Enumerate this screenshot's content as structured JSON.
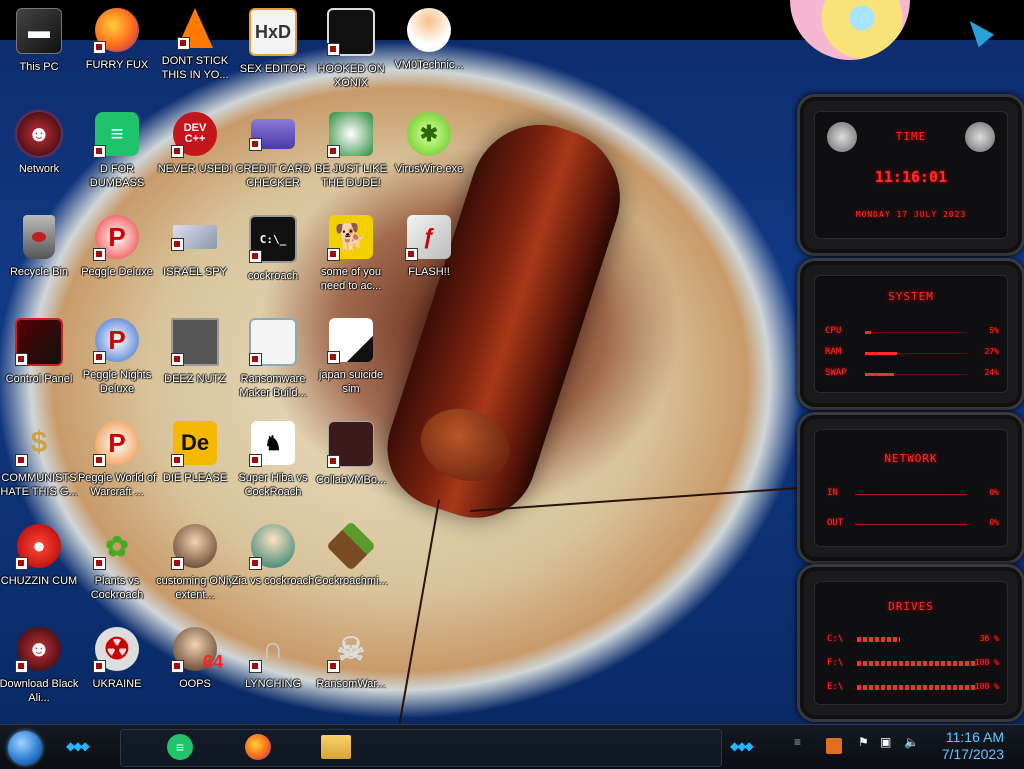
{
  "desktop": {
    "icons": [
      {
        "label": "This PC"
      },
      {
        "label": "FURRY FUX"
      },
      {
        "label": "DONT STICK THIS IN YO..."
      },
      {
        "label": "SEX EDITOR"
      },
      {
        "label": "HOOKED ON XONIX"
      },
      {
        "label": "VM0Technic..."
      },
      {
        "label": "Network"
      },
      {
        "label": "D FOR DUMBASS"
      },
      {
        "label": "NEVER USED!"
      },
      {
        "label": "CREDIT CARD CHECKER"
      },
      {
        "label": "BE JUST LIKE THE DUDE!"
      },
      {
        "label": "VirusWire.exe"
      },
      {
        "label": "Recycle Bin"
      },
      {
        "label": "Peggle Deluxe"
      },
      {
        "label": "ISRAEL SPY"
      },
      {
        "label": "cockroach"
      },
      {
        "label": "some of you need to ac..."
      },
      {
        "label": "FLASH!!"
      },
      {
        "label": "Control Panel"
      },
      {
        "label": "Peggle Nights Deluxe"
      },
      {
        "label": "DEEZ NUTZ"
      },
      {
        "label": "Ransomware Maker Build..."
      },
      {
        "label": "japan suicide sim"
      },
      {
        "label": "COMMUNISTS HATE THIS G..."
      },
      {
        "label": "Peggle World of Warcraft ..."
      },
      {
        "label": "DIE PLEASE"
      },
      {
        "label": "Super Hiba vs CockRoach"
      },
      {
        "label": "CollabVMBo..."
      },
      {
        "label": "CHUZZIN CUM"
      },
      {
        "label": "Plants vs Cockroach"
      },
      {
        "label": "customing ONly extent..."
      },
      {
        "label": "Zia vs cockroach"
      },
      {
        "label": "Cockroachmi..."
      },
      {
        "label": "Download Black Ali..."
      },
      {
        "label": "UKRAINE"
      },
      {
        "label": "OOPS"
      },
      {
        "label": "LYNCHING"
      },
      {
        "label": "RansomWar..."
      }
    ],
    "icon_badges": {
      "dev": "DEV",
      "dev_sub": "C++",
      "de": "De",
      "cmd": "C:\\_",
      "oops_num": "64"
    }
  },
  "gadgets": {
    "time": {
      "title": "TIME",
      "time": "11:16:01",
      "date": "MONDAY 17 JULY 2023"
    },
    "system": {
      "title": "SYSTEM",
      "rows": [
        {
          "label": "CPU",
          "value": "5%",
          "level": 0.05
        },
        {
          "label": "RAM",
          "value": "27%",
          "level": 0.27
        },
        {
          "label": "SWAP",
          "value": "24%",
          "level": 0.24
        }
      ]
    },
    "network": {
      "title": "NETWORK",
      "rows": [
        {
          "label": "IN",
          "value": "0%"
        },
        {
          "label": "OUT",
          "value": "0%"
        }
      ]
    },
    "drives": {
      "title": "DRIVES",
      "rows": [
        {
          "label": "C:\\",
          "value": "36 %",
          "level": 0.36
        },
        {
          "label": "F:\\",
          "value": "100 %",
          "level": 1.0
        },
        {
          "label": "E:\\",
          "value": "100 %",
          "level": 1.0
        }
      ]
    }
  },
  "taskbar": {
    "clock_time": "11:16 AM",
    "clock_date": "7/17/2023",
    "apps": [
      "Notes",
      "Firefox",
      "File Explorer"
    ]
  },
  "colors": {
    "accent_red": "#ff2a2a",
    "clock_blue": "#5ec8ff",
    "taskbar_chevron": "#25b4ff"
  }
}
